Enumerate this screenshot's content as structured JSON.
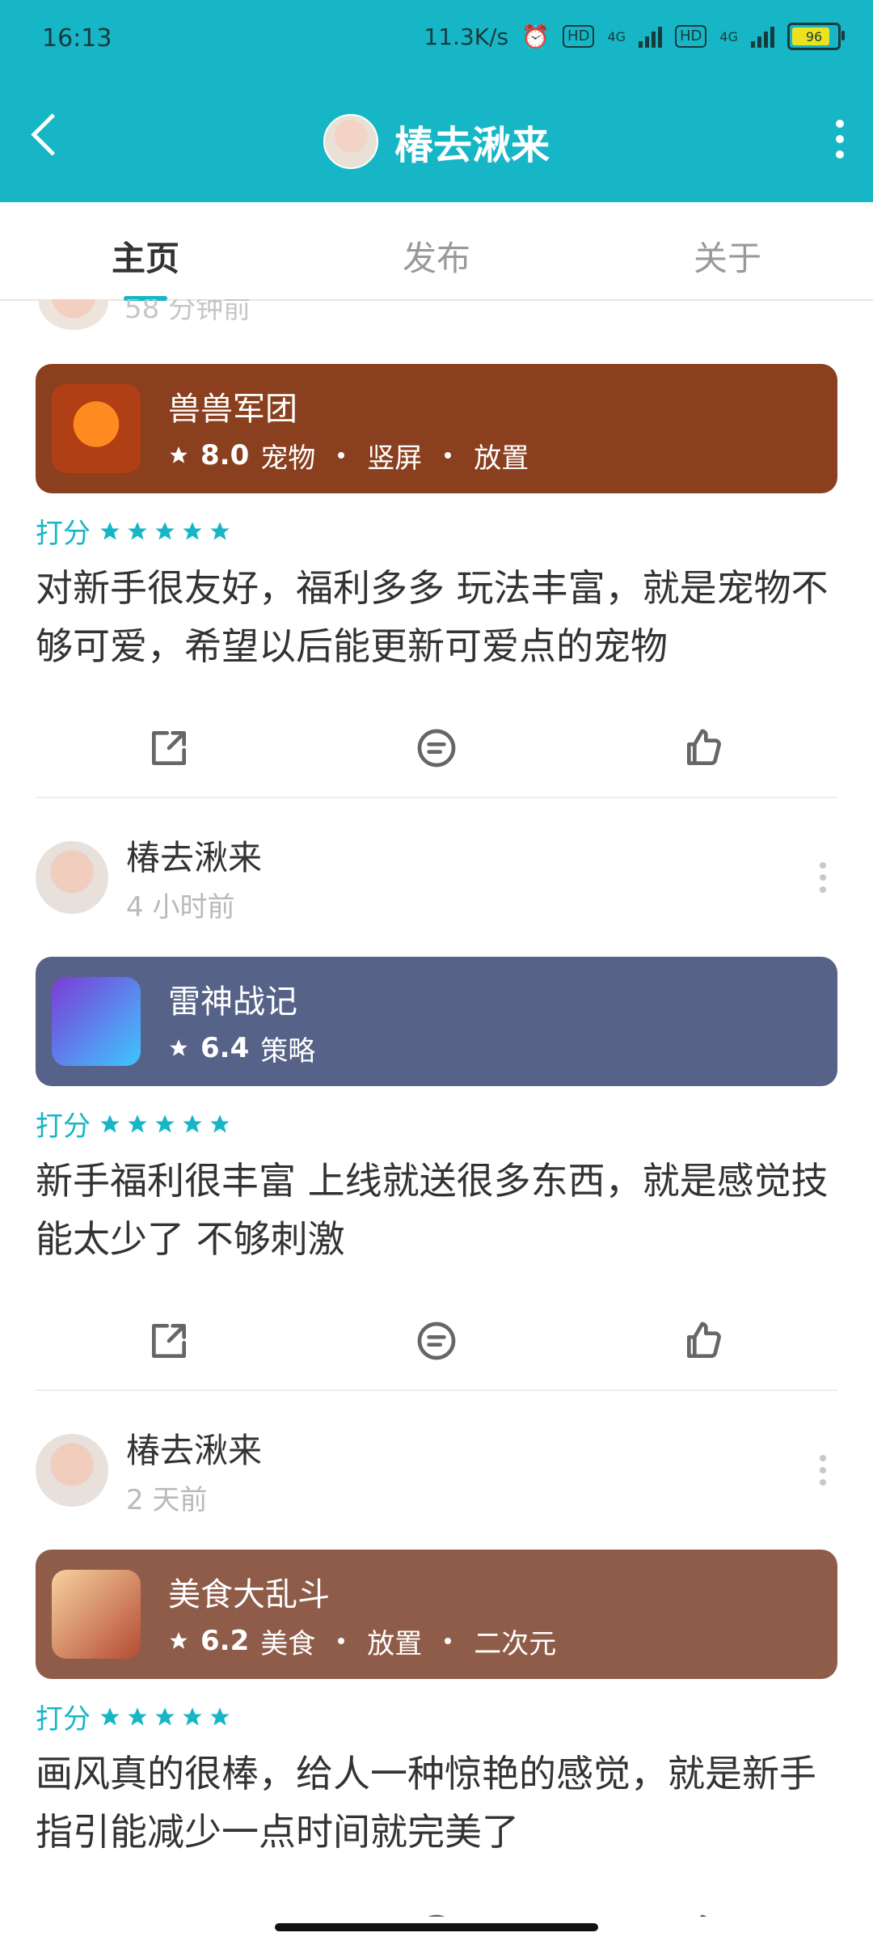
{
  "status": {
    "time": "16:13",
    "speed": "11.3K/s",
    "hd1": "HD",
    "net1": "4G",
    "hd2": "HD",
    "net2": "4G",
    "battery": "96"
  },
  "header": {
    "title": "椿去湫来"
  },
  "tabs": [
    {
      "label": "主页"
    },
    {
      "label": "发布"
    },
    {
      "label": "关于"
    }
  ],
  "first_post": {
    "time_partial": "58 分钟前",
    "game": {
      "name": "兽兽军团",
      "rating": "8.0",
      "tags": [
        "宠物",
        "竖屏",
        "放置"
      ],
      "color": "#8a3f1f",
      "icon_bg": "#b13f16"
    },
    "score_label": "打分",
    "review": "对新手很友好，福利多多 玩法丰富，就是宠物不够可爱，希望以后能更新可爱点的宠物"
  },
  "posts": [
    {
      "user": "椿去湫来",
      "time": "4 小时前",
      "game": {
        "name": "雷神战记",
        "rating": "6.4",
        "tags": [
          "策略"
        ],
        "color": "#566287",
        "icon_bg": "#6a48b8"
      },
      "score_label": "打分",
      "review": "新手福利很丰富 上线就送很多东西，就是感觉技能太少了 不够刺激"
    },
    {
      "user": "椿去湫来",
      "time": "2 天前",
      "game": {
        "name": "美食大乱斗",
        "rating": "6.2",
        "tags": [
          "美食",
          "放置",
          "二次元"
        ],
        "color": "#8f5c4a",
        "icon_bg": "#b46b56"
      },
      "score_label": "打分",
      "review": "画风真的很棒，给人一种惊艳的感觉，就是新手指引能减少一点时间就完美了"
    }
  ],
  "colors": {
    "accent": "#17b6c6"
  }
}
